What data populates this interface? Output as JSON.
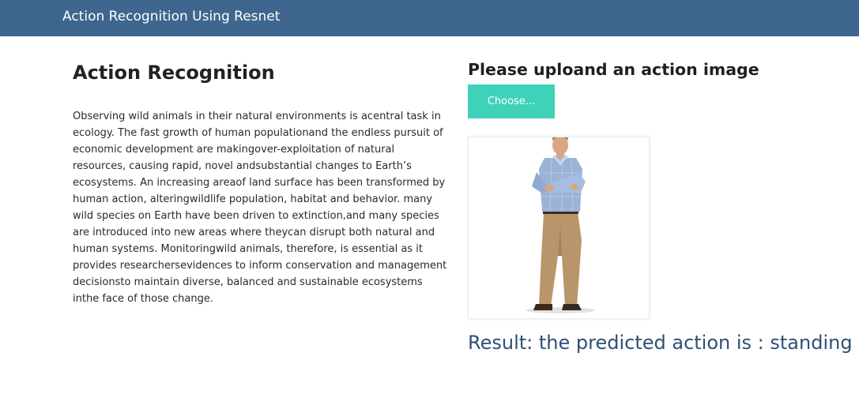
{
  "navbar": {
    "brand": "Action Recognition Using Resnet"
  },
  "left": {
    "title": "Action Recognition",
    "body": "Observing wild animals in their natural environments is acentral task in ecology. The fast growth of human populationand the endless pursuit of economic development are makingover-exploitation of natural resources, causing rapid, novel andsubstantial changes to Earth’s ecosystems. An increasing areaof land surface has been transformed by human action, alteringwildlife population, habitat and behavior. many wild species on Earth have been driven to extinction,and many species are introduced into new areas where theycan disrupt both natural and human systems. Monitoringwild animals, therefore, is essential as it provides researchersevidences to inform conservation and management decisionsto maintain diverse, balanced and sustainable ecosystems inthe face of those change."
  },
  "upload": {
    "title": "Please uploand an action image",
    "button_label": "Choose..."
  },
  "result": {
    "text": "Result: the predicted action is : standing"
  },
  "colors": {
    "navbar": "#3f668e",
    "button": "#3fd2b8",
    "result_text": "#2f4f75"
  }
}
